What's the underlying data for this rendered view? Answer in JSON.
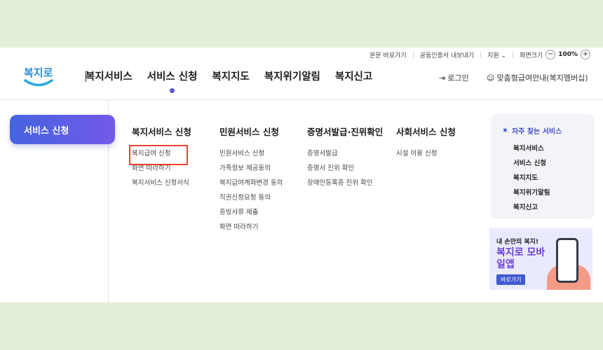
{
  "util": {
    "skip": "본문 바로가기",
    "cert": "공동인증서 내보내기",
    "support": "지원",
    "screen_size": "화면크기",
    "zoom_minus": "−",
    "zoom": "100%",
    "zoom_plus": "+"
  },
  "logo": {
    "text": "복지로"
  },
  "gnb": [
    "복지서비스",
    "서비스 신청",
    "복지지도",
    "복지위기알림",
    "복지신고"
  ],
  "header": {
    "login": "로그인",
    "member": "맞춤형급여안내(복지멤버십)"
  },
  "left": {
    "active": "서비스 신청"
  },
  "columns": [
    {
      "title": "복지서비스 신청",
      "items": [
        "복지급여 신청",
        "화면 따라하기",
        "복지서비스 신청서식"
      ]
    },
    {
      "title": "민원서비스 신청",
      "items": [
        "민원서비스 신청",
        "가족정보 제공동의",
        "복지급여계좌변경 동의",
        "직권신청요청 동의",
        "증빙서류 제출",
        "화면 따라하기"
      ]
    },
    {
      "title": "증명서발급·진위확인",
      "items": [
        "증명서발급",
        "증명서 진위 확인",
        "장애인등록증 진위 확인"
      ]
    },
    {
      "title": "사회서비스 신청",
      "items": [
        "시설 이용 신청"
      ]
    }
  ],
  "fav": {
    "title": "자주 찾는 서비스",
    "items": [
      "복지서비스",
      "서비스 신청",
      "복지지도",
      "복지위기알림",
      "복지신고"
    ]
  },
  "banner": {
    "line1": "내 손안의 복지!",
    "line2": "복지로 모바일앱",
    "button": "바로가기"
  },
  "colors": {
    "accent": "#5a57d6",
    "highlight": "#e8442e",
    "background": "#e3efd8"
  }
}
